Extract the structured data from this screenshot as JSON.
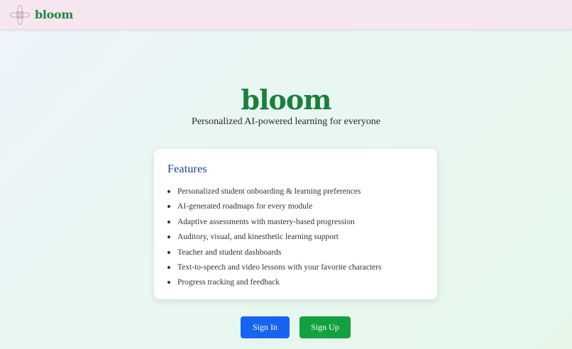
{
  "nav": {
    "brand": "bloom"
  },
  "hero": {
    "title": "bloom",
    "subtitle": "Personalized AI-powered learning for everyone"
  },
  "features": {
    "heading": "Features",
    "items": [
      "Personalized student onboarding & learning preferences",
      "AI-generated roadmaps for every module",
      "Adaptive assessments with mastery-based progression",
      "Auditory, visual, and kinesthetic learning support",
      "Teacher and student dashboards",
      "Text-to-speech and video lessons with your favorite characters",
      "Progress tracking and feedback"
    ]
  },
  "buttons": {
    "sign_in": "Sign In",
    "sign_up": "Sign Up"
  },
  "colors": {
    "brand_green": "#1a7f3a",
    "sign_in_blue": "#1664f0",
    "sign_up_green": "#12a13f",
    "nav_background": "#f5e6f0",
    "heading_navy": "#1e3a8a"
  },
  "icons": {
    "logo": "flower-icon"
  }
}
